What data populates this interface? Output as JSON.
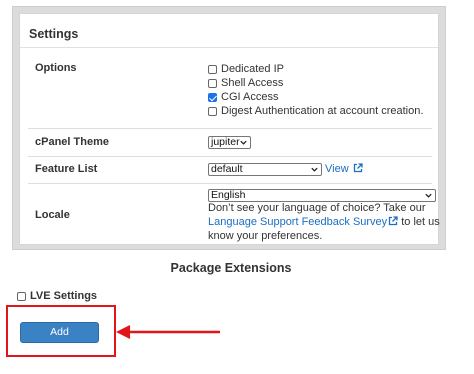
{
  "settings": {
    "title": "Settings",
    "options": {
      "label": "Options",
      "items": [
        {
          "label": "Dedicated IP",
          "checked": false
        },
        {
          "label": "Shell Access",
          "checked": false
        },
        {
          "label": "CGI Access",
          "checked": true
        },
        {
          "label": "Digest Authentication at account creation.",
          "checked": false
        }
      ]
    },
    "cpanel_theme": {
      "label": "cPanel Theme",
      "value": "jupiter"
    },
    "feature_list": {
      "label": "Feature List",
      "value": "default",
      "link": "View"
    },
    "locale": {
      "label": "Locale",
      "value": "English",
      "help_line1": "Don’t see your language of choice? Take our",
      "help_link": "Language Support Feedback Survey",
      "help_after_link": " to let us",
      "help_line3": "know your preferences."
    }
  },
  "package_extensions": {
    "title": "Package Extensions",
    "lve_settings": {
      "label": "LVE Settings",
      "checked": false
    }
  },
  "add_button": {
    "label": "Add"
  },
  "colors": {
    "accent": "#1b6ec2",
    "button": "#3b82c4",
    "highlight": "#e0161b",
    "checked": "#1a73e8"
  },
  "icons": [
    "external-link-icon",
    "chevron-down-icon",
    "checkbox-icon",
    "arrow-left-icon"
  ]
}
